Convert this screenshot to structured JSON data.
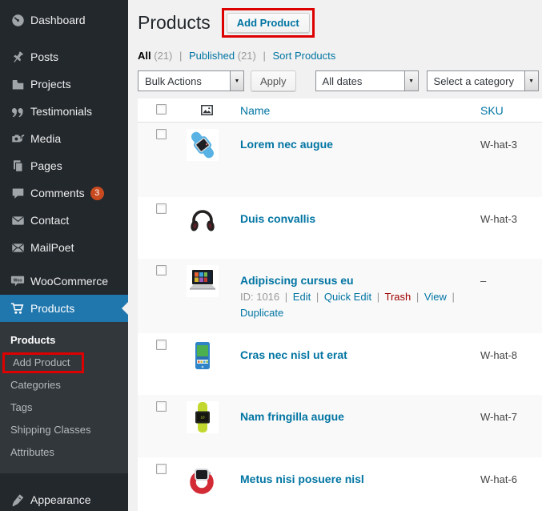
{
  "sidebar": {
    "items": [
      {
        "label": "Dashboard",
        "icon": "dashboard-icon"
      },
      {
        "label": "Posts",
        "icon": "pushpin-icon"
      },
      {
        "label": "Projects",
        "icon": "folder-icon"
      },
      {
        "label": "Testimonials",
        "icon": "quote-icon"
      },
      {
        "label": "Media",
        "icon": "media-camera-icon"
      },
      {
        "label": "Pages",
        "icon": "pages-icon"
      },
      {
        "label": "Comments",
        "icon": "comment-bubble-icon",
        "badge": "3"
      },
      {
        "label": "Contact",
        "icon": "envelope-icon"
      },
      {
        "label": "MailPoet",
        "icon": "mailpoet-envelope-icon"
      },
      {
        "label": "WooCommerce",
        "icon": "woocommerce-bubble-icon"
      },
      {
        "label": "Products",
        "icon": "shopping-cart-icon",
        "active": true
      },
      {
        "label": "Appearance",
        "icon": "paintbrush-icon"
      }
    ],
    "submenu": [
      {
        "label": "Products",
        "current": true
      },
      {
        "label": "Add Product",
        "annotated": true
      },
      {
        "label": "Categories"
      },
      {
        "label": "Tags"
      },
      {
        "label": "Shipping Classes"
      },
      {
        "label": "Attributes"
      }
    ]
  },
  "header": {
    "title": "Products",
    "add_product": "Add Product"
  },
  "views": {
    "all": "All",
    "all_count": "(21)",
    "published": "Published",
    "published_count": "(21)",
    "sort": "Sort Products",
    "separator": "|"
  },
  "toolbar": {
    "bulk_actions": "Bulk Actions",
    "apply": "Apply",
    "all_dates": "All dates",
    "select_category": "Select a category",
    "dropdown_arrow": "▼"
  },
  "table": {
    "columns": {
      "name": "Name",
      "sku": "SKU"
    },
    "separator": "|",
    "rows": [
      {
        "name": "Lorem nec augue",
        "sku": "W-hat-3",
        "image": "blue-smartwatch"
      },
      {
        "name": "Duis convallis",
        "sku": "W-hat-3",
        "image": "black-headphones"
      },
      {
        "name": "Adipiscing cursus eu",
        "sku": "–",
        "image": "laptop",
        "actions": {
          "id": "ID: 1016",
          "edit": "Edit",
          "quick_edit": "Quick Edit",
          "trash": "Trash",
          "view": "View",
          "duplicate": "Duplicate"
        }
      },
      {
        "name": "Cras nec nisl ut erat",
        "sku": "W-hat-8",
        "image": "blue-tablet"
      },
      {
        "name": "Nam fringilla augue",
        "sku": "W-hat-7",
        "image": "lime-smartwatch"
      },
      {
        "name": "Metus nisi posuere nisl",
        "sku": "W-hat-6",
        "image": "red-smartwatch"
      }
    ]
  },
  "colors": {
    "sidebar_bg": "#23282d",
    "submenu_bg": "#32373c",
    "menu_active_bg": "#2077ae",
    "content_bg": "#f1f1f1",
    "link_blue": "#0074a2",
    "annotation_red": "#dd0000",
    "badge_orange": "#ca4a1f",
    "trash_red": "#a00000",
    "stripe": "#f9f9f9"
  }
}
